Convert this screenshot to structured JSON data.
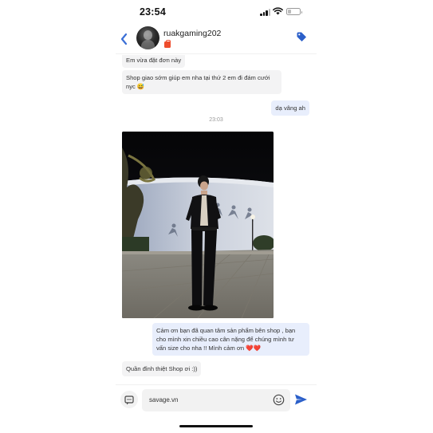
{
  "status_bar": {
    "time": "23:54",
    "battery_level": 0.3
  },
  "header": {
    "username": "ruakgaming202"
  },
  "messages": [
    {
      "side": "in",
      "text": "Em vừa đặt đơn này"
    },
    {
      "side": "in",
      "text": "Shop giao sớm giúp em nha tại thứ 2 em đi đám cưới nyc 😅"
    },
    {
      "side": "out",
      "text": "dạ vâng ah"
    },
    {
      "type": "time",
      "text": "23:03"
    },
    {
      "type": "image",
      "side": "in"
    },
    {
      "side": "out",
      "text": "Cảm ơn bạn đã quan tâm sản phẩm bên shop , bạn cho mình xin chiều cao cân nặng để chúng mình tư vấn size cho nha !! Mình cảm ơn ❤️❤️"
    },
    {
      "side": "in",
      "text": "Quần đỉnh thiệt Shop ơi :))"
    }
  ],
  "input": {
    "value": "savage.vn"
  },
  "colors": {
    "accent": "#3b6fd6",
    "shop_badge": "#ee4d2d",
    "incoming_bubble": "#f3f3f4",
    "outgoing_bubble": "#e8eefc"
  }
}
